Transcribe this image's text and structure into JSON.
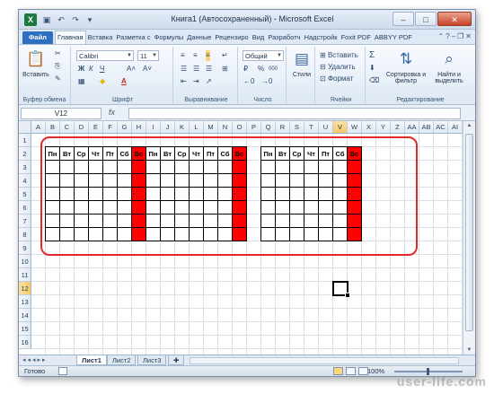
{
  "window": {
    "title": "Книга1 (Автосохраненный) - Microsoft Excel",
    "app_logo": "X",
    "qat": [
      "save-icon",
      "undo-icon",
      "redo-icon",
      "dropdown-icon"
    ],
    "controls": {
      "minimize": "–",
      "maximize": "□",
      "close": "✕"
    }
  },
  "ribbon": {
    "tabs": [
      {
        "label": "Файл",
        "file": true
      },
      {
        "label": "Главная",
        "active": true
      },
      {
        "label": "Вставка"
      },
      {
        "label": "Разметка с"
      },
      {
        "label": "Формулы"
      },
      {
        "label": "Данные"
      },
      {
        "label": "Рецензиро"
      },
      {
        "label": "Вид"
      },
      {
        "label": "Разработч"
      },
      {
        "label": "Надстройк"
      },
      {
        "label": "Foxit PDF"
      },
      {
        "label": "ABBYY PDF"
      }
    ],
    "groups": {
      "clipboard": {
        "label": "Буфер обмена",
        "paste_label": "Вставить"
      },
      "font": {
        "label": "Шрифт",
        "font_name": "Calibri",
        "font_size": "11",
        "bold": "Ж",
        "italic": "К",
        "underline": "Ч",
        "grow": "A˄",
        "shrink": "A˅",
        "font_color": "A"
      },
      "alignment": {
        "label": "Выравнивание"
      },
      "number": {
        "label": "Число",
        "format": "Общий",
        "percent": "%",
        "thousands": "000"
      },
      "styles": {
        "label": "Стили"
      },
      "cells": {
        "label": "Ячейки",
        "insert": "Вставить",
        "delete": "Удалить",
        "format": "Формат"
      },
      "editing": {
        "label": "Редактирование",
        "sort": "Сортировка и фильтр",
        "find": "Найти и выделить",
        "sum": "Σ"
      }
    }
  },
  "formula_bar": {
    "name_box": "V12",
    "fx": "fx",
    "value": ""
  },
  "grid": {
    "columns": [
      "A",
      "B",
      "C",
      "D",
      "E",
      "F",
      "G",
      "H",
      "I",
      "J",
      "K",
      "L",
      "M",
      "N",
      "O",
      "P",
      "Q",
      "R",
      "S",
      "T",
      "U",
      "V",
      "W",
      "X",
      "Y",
      "Z",
      "AA",
      "AB",
      "AC",
      "AI"
    ],
    "selected_column": "V",
    "rows": [
      "1",
      "2",
      "3",
      "4",
      "5",
      "6",
      "7",
      "8",
      "9",
      "10",
      "11",
      "12",
      "13",
      "14",
      "15",
      "16"
    ],
    "selected_row": "12",
    "calendars": [
      {
        "days": [
          "Пн",
          "Вт",
          "Ср",
          "Чт",
          "Пт",
          "Сб",
          "Вс"
        ],
        "empty_rows": 6
      },
      {
        "days": [
          "Пн",
          "Вт",
          "Ср",
          "Чт",
          "Пт",
          "Сб",
          "Вс"
        ],
        "empty_rows": 6
      },
      {
        "days": [
          "Пн",
          "Вт",
          "Ср",
          "Чт",
          "Пт",
          "Сб",
          "Вс"
        ],
        "empty_rows": 6
      }
    ]
  },
  "sheets": {
    "tabs": [
      "Лист1",
      "Лист2",
      "Лист3"
    ],
    "active": "Лист1"
  },
  "status_bar": {
    "status": "Готово",
    "zoom": "100%"
  },
  "watermark": "user-life.com",
  "colors": {
    "sunday": "#ff0000",
    "highlight": "#e02a2a",
    "file_tab": "#2f6fc1"
  }
}
